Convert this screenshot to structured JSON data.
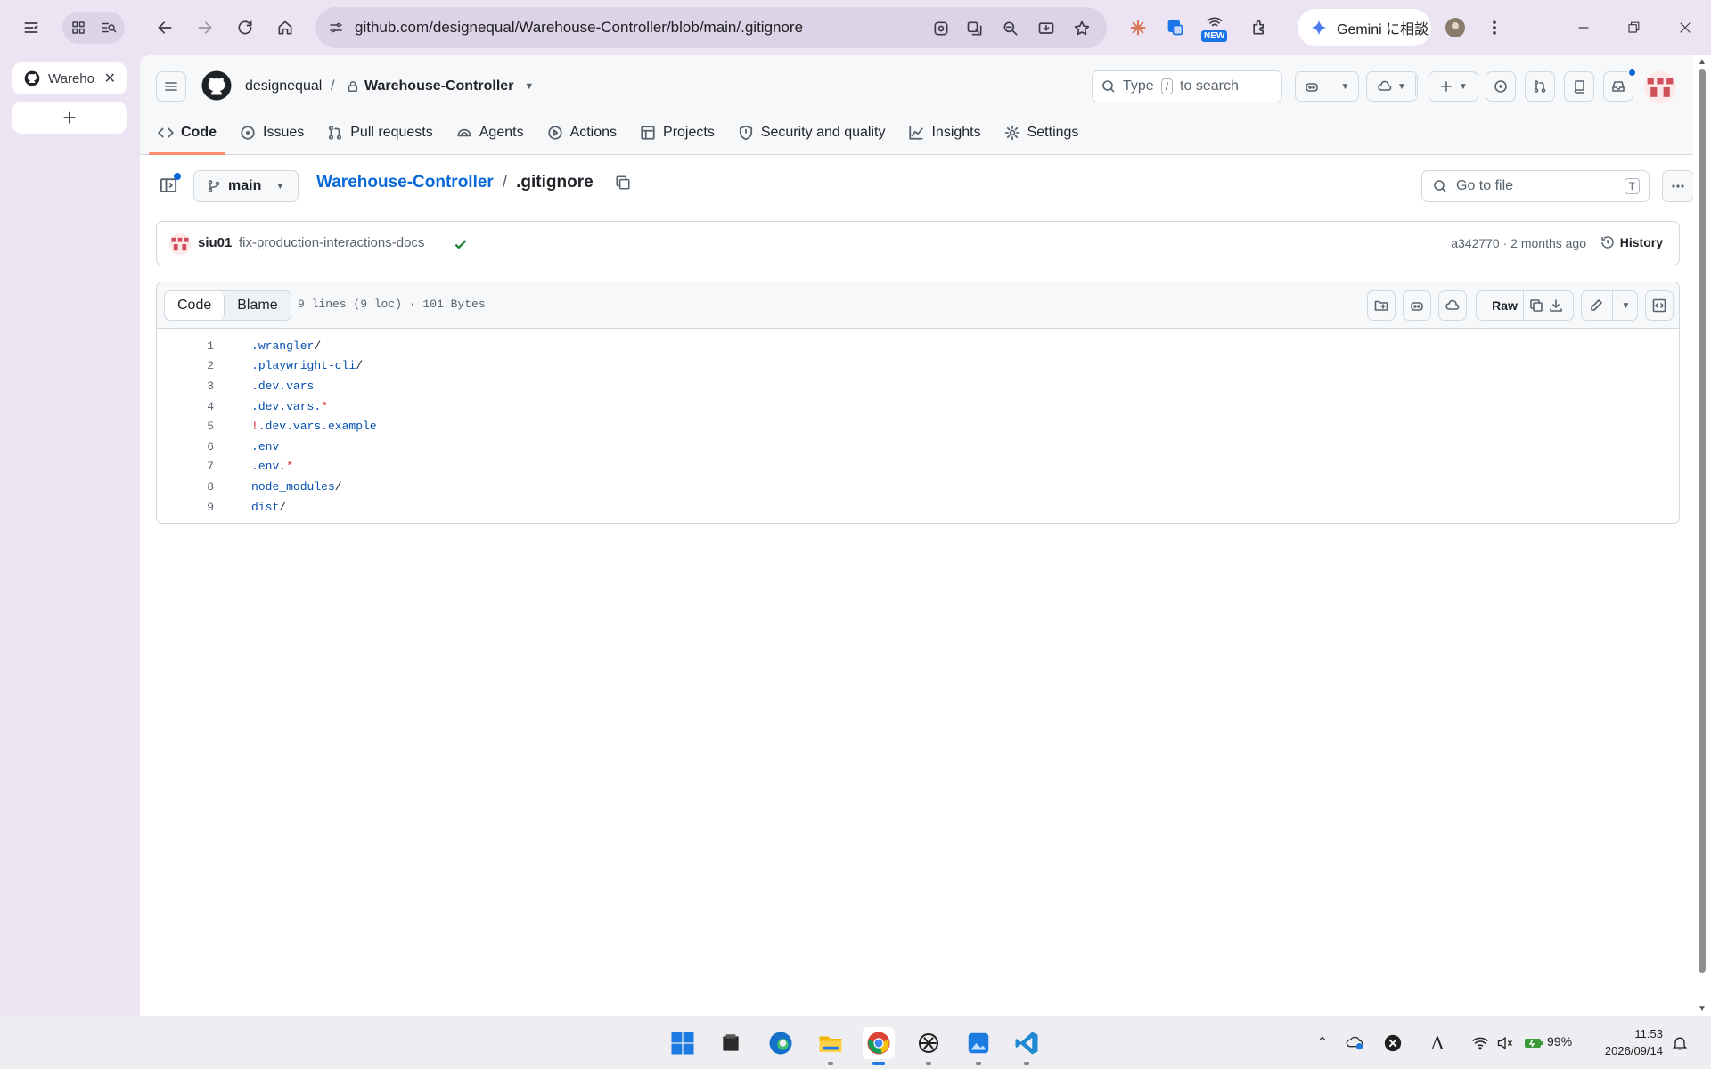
{
  "browser": {
    "url": "github.com/designequal/Warehouse-Controller/blob/main/.gitignore",
    "gemini_label": "Gemini に相談",
    "new_badge": "NEW",
    "tab_title": "Warehouse-Controller"
  },
  "header": {
    "owner": "designequal",
    "separator": "/",
    "repo": "Warehouse-Controller",
    "search_prefix": "Type",
    "search_key": "/",
    "search_suffix": "to search"
  },
  "repo_nav": [
    {
      "label": "Code",
      "icon": "code-icon"
    },
    {
      "label": "Issues",
      "icon": "issue-icon"
    },
    {
      "label": "Pull requests",
      "icon": "pull-request-icon"
    },
    {
      "label": "Agents",
      "icon": "agents-icon"
    },
    {
      "label": "Actions",
      "icon": "actions-icon"
    },
    {
      "label": "Projects",
      "icon": "projects-icon"
    },
    {
      "label": "Security and quality",
      "icon": "shield-icon"
    },
    {
      "label": "Insights",
      "icon": "graph-icon"
    },
    {
      "label": "Settings",
      "icon": "gear-icon"
    }
  ],
  "file_nav": {
    "branch": "main",
    "path_repo": "Warehouse-Controller",
    "path_sep": "/",
    "path_file": ".gitignore",
    "goto_placeholder": "Go to file",
    "goto_key": "T"
  },
  "commit": {
    "author": "siu01",
    "message": "fix-production-interactions-docs",
    "meta": "a342770 · 2 months ago",
    "history": "History"
  },
  "file_view": {
    "tab_code": "Code",
    "tab_blame": "Blame",
    "info": "9 lines (9 loc) · 101 Bytes",
    "raw": "Raw",
    "lines": [
      {
        "n": "1",
        "text": ".wrangler/"
      },
      {
        "n": "2",
        "text": ".playwright-cli/"
      },
      {
        "n": "3",
        "text": ".dev.vars"
      },
      {
        "n": "4",
        "text": ".dev.vars.*"
      },
      {
        "n": "5",
        "text": "!.dev.vars.example"
      },
      {
        "n": "6",
        "text": ".env"
      },
      {
        "n": "7",
        "text": ".env.*"
      },
      {
        "n": "8",
        "text": "node_modules/"
      },
      {
        "n": "9",
        "text": "dist/"
      }
    ]
  },
  "taskbar": {
    "battery": "99%",
    "time": "11:53",
    "date": "2026/09/14"
  },
  "colors": {
    "accent_link": "#0969da",
    "tab_underline": "#fd8c73",
    "browser_bg": "#ece3f3"
  }
}
